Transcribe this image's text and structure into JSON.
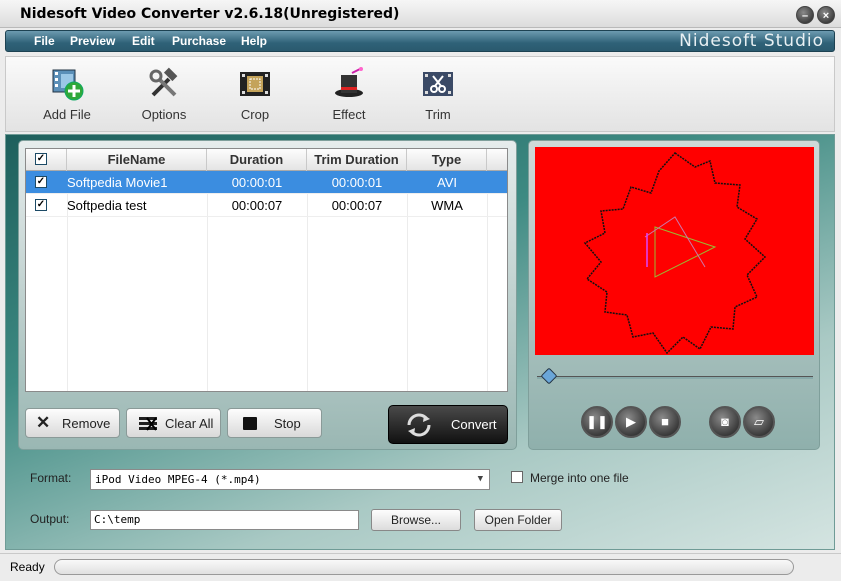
{
  "window": {
    "title": "Nidesoft Video Converter v2.6.18(Unregistered)"
  },
  "menu": {
    "items": [
      "File",
      "Preview",
      "Edit",
      "Purchase",
      "Help"
    ],
    "brand": "Nidesoft Studio"
  },
  "toolbar": {
    "add_file": "Add File",
    "options": "Options",
    "crop": "Crop",
    "effect": "Effect",
    "trim": "Trim"
  },
  "file_list": {
    "columns": [
      "FileName",
      "Duration",
      "Trim Duration",
      "Type"
    ],
    "rows": [
      {
        "name": "Softpedia Movie1",
        "duration": "00:00:01",
        "trim": "00:00:01",
        "type": "AVI",
        "checked": true,
        "selected": true
      },
      {
        "name": "Softpedia test",
        "duration": "00:00:07",
        "trim": "00:00:07",
        "type": "WMA",
        "checked": true,
        "selected": false
      }
    ]
  },
  "buttons": {
    "remove": "Remove",
    "clear_all": "Clear All",
    "stop": "Stop",
    "convert": "Convert"
  },
  "preview": {
    "background": "#ff0000",
    "seek_position": 0.02
  },
  "settings": {
    "format_label": "Format:",
    "format_value": "iPod Video MPEG-4 (*.mp4)",
    "merge_label": "Merge into one file",
    "output_label": "Output:",
    "output_value": "C:\\temp",
    "browse_label": "Browse...",
    "open_folder_label": "Open Folder"
  },
  "status": {
    "text": "Ready",
    "progress": 0
  }
}
